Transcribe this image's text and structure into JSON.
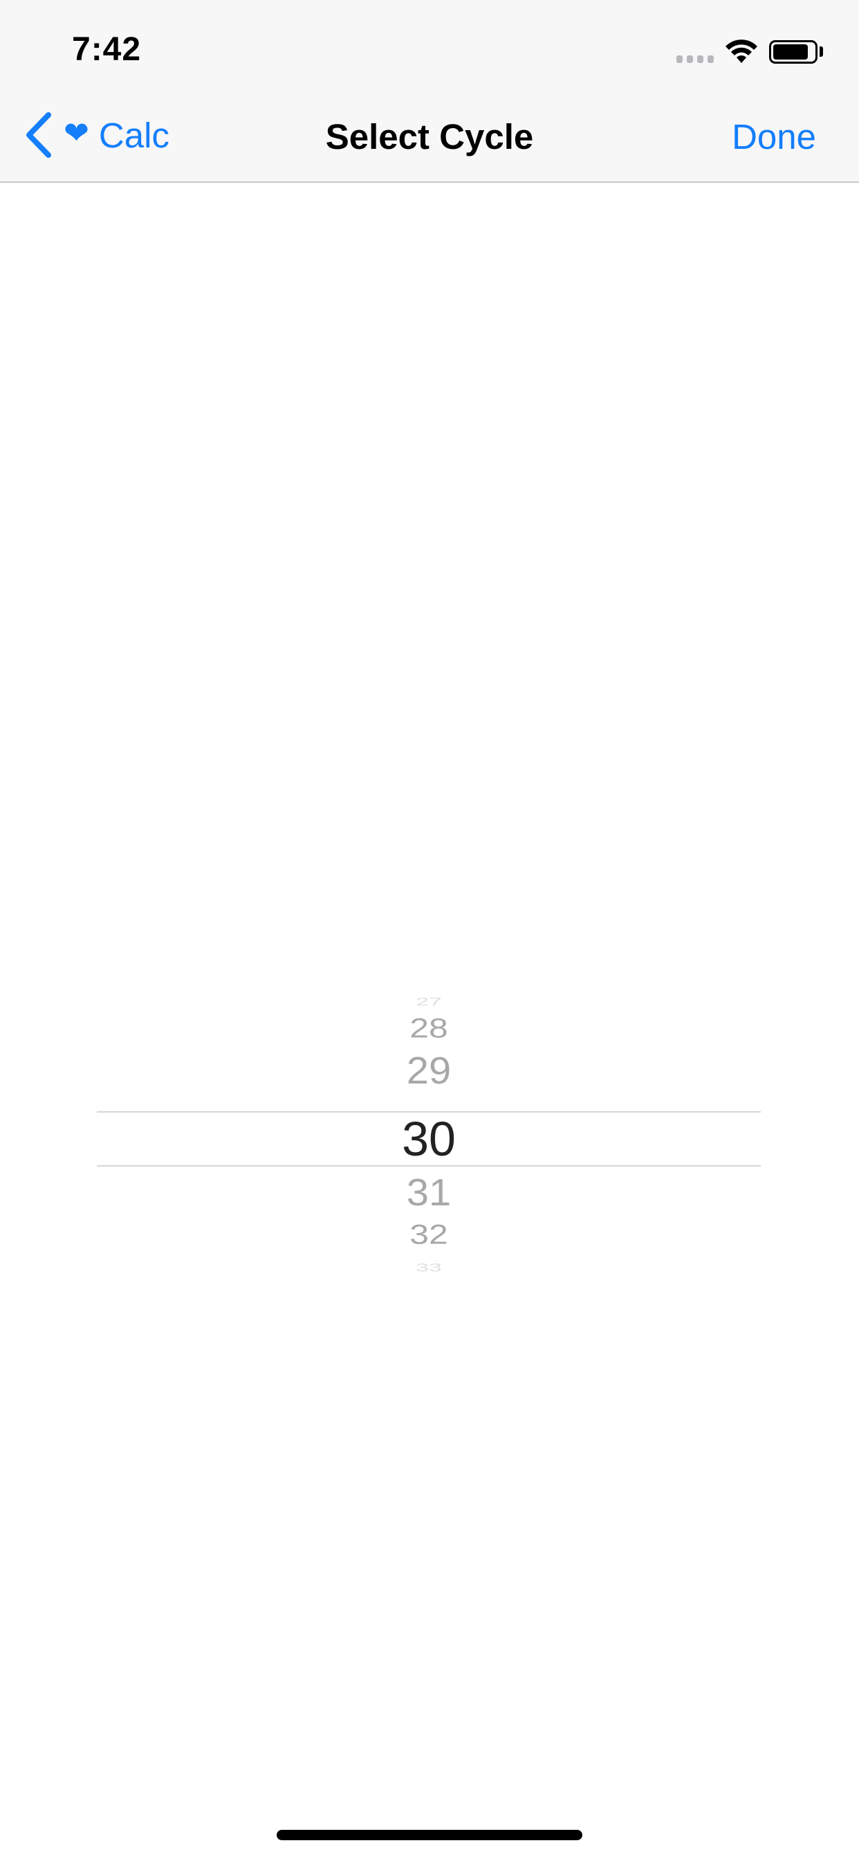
{
  "status_bar": {
    "time": "7:42",
    "icons": [
      "cellular-signal-icon",
      "wifi-icon",
      "battery-icon"
    ]
  },
  "nav_bar": {
    "back_label": "Calc",
    "back_icon": "chevron-left-icon",
    "back_badge_icon": "heart-icon",
    "title": "Select Cycle",
    "done_label": "Done"
  },
  "picker": {
    "items": [
      "27",
      "28",
      "29",
      "30",
      "31",
      "32",
      "33"
    ],
    "selected": "30"
  },
  "colors": {
    "accent": "#147efb",
    "nav_background": "#f7f7f8",
    "picker_text": "#a8a8aa",
    "picker_selected_text": "#222222"
  }
}
